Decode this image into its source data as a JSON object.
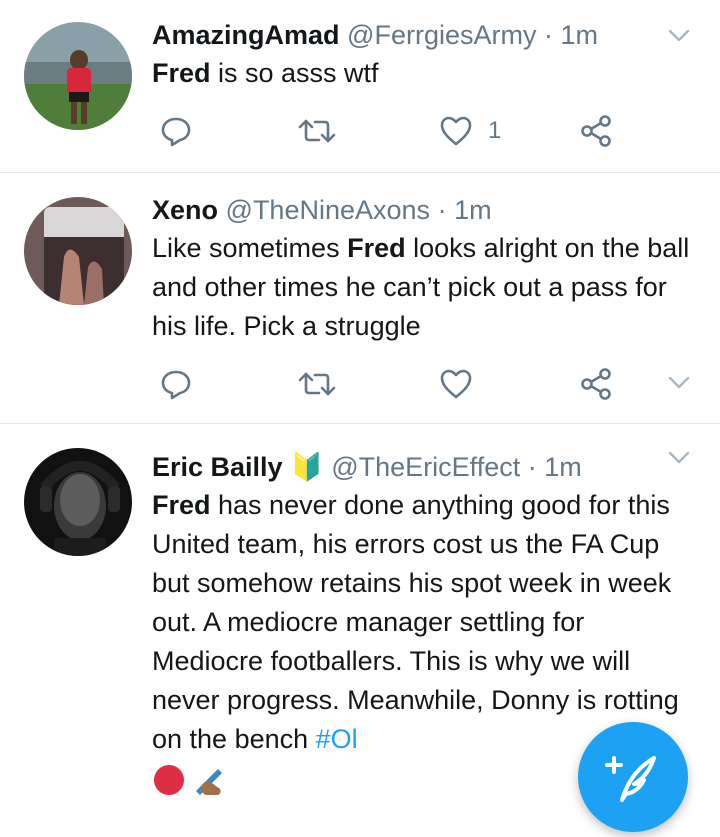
{
  "tweets": [
    {
      "name": "AmazingAmad",
      "handle": "@FerrgiesArmy",
      "separator": "·",
      "time": "1m",
      "text_bold": "Fred",
      "text_rest": " is so asss wtf",
      "like_count": "1",
      "avatar": "football-player-avatar"
    },
    {
      "name": "Xeno",
      "handle": "@TheNineAxons",
      "separator": "·",
      "time": "1m",
      "text_pre": "Like sometimes ",
      "text_bold": "Fred",
      "text_rest": " looks alright on the ball and other times he can’t pick out a pass for his life. Pick a struggle",
      "like_count": "",
      "avatar": "hand-photo-avatar"
    },
    {
      "name": "Eric Bailly",
      "badge": "🔰",
      "handle": "@TheEricEffect",
      "separator": "·",
      "time": "1m",
      "text_bold": "Fred",
      "text_rest": " has never done anything good for this United team, his errors cost us the FA Cup but somehow retains his spot week in week out. A mediocre manager settling for Mediocre footballers. This is why we will never progress. Meanwhile, Donny is rotting on the bench ",
      "hashtag": "#Ol",
      "avatar": "headphones-portrait-avatar"
    }
  ],
  "icons": {
    "reply": "reply-icon",
    "retweet": "retweet-icon",
    "like": "heart-icon",
    "share": "share-icon",
    "menu": "chevron-down-icon",
    "compose": "compose-tweet-icon"
  },
  "colors": {
    "accent": "#1da1f2",
    "secondary_text": "#657786",
    "divider": "#e1e8ed"
  }
}
